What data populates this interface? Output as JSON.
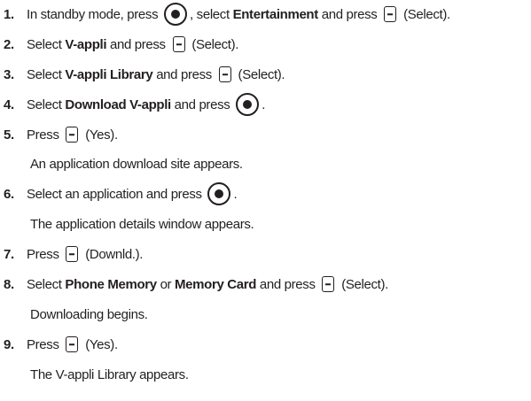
{
  "steps": [
    {
      "number": "1.",
      "parts": [
        {
          "text": "In standby mode, press "
        },
        {
          "icon": "center-key-icon"
        },
        {
          "text": ", select "
        },
        {
          "text": "Entertainment",
          "bold": true
        },
        {
          "text": " and press "
        },
        {
          "icon": "softkey-icon"
        },
        {
          "text": " (Select)."
        }
      ]
    },
    {
      "number": "2.",
      "parts": [
        {
          "text": "Select "
        },
        {
          "text": "V-appli",
          "bold": true
        },
        {
          "text": " and press "
        },
        {
          "icon": "softkey-icon"
        },
        {
          "text": " (Select)."
        }
      ]
    },
    {
      "number": "3.",
      "parts": [
        {
          "text": "Select "
        },
        {
          "text": "V-appli Library",
          "bold": true
        },
        {
          "text": " and press "
        },
        {
          "icon": "softkey-icon"
        },
        {
          "text": " (Select)."
        }
      ]
    },
    {
      "number": "4.",
      "parts": [
        {
          "text": "Select "
        },
        {
          "text": "Download V-appli",
          "bold": true
        },
        {
          "text": " and press "
        },
        {
          "icon": "center-key-icon"
        },
        {
          "text": "."
        }
      ]
    },
    {
      "number": "5.",
      "parts": [
        {
          "text": "Press "
        },
        {
          "icon": "softkey-icon"
        },
        {
          "text": " (Yes)."
        }
      ],
      "note": "An application download site appears."
    },
    {
      "number": "6.",
      "parts": [
        {
          "text": "Select an application and press "
        },
        {
          "icon": "center-key-icon"
        },
        {
          "text": "."
        }
      ],
      "note": "The application details window appears."
    },
    {
      "number": "7.",
      "parts": [
        {
          "text": "Press "
        },
        {
          "icon": "softkey-icon"
        },
        {
          "text": " (Downld.)."
        }
      ]
    },
    {
      "number": "8.",
      "parts": [
        {
          "text": "Select "
        },
        {
          "text": "Phone Memory",
          "bold": true
        },
        {
          "text": " or "
        },
        {
          "text": "Memory Card",
          "bold": true
        },
        {
          "text": " and press "
        },
        {
          "icon": "softkey-icon"
        },
        {
          "text": " (Select)."
        }
      ],
      "note": "Downloading begins."
    },
    {
      "number": "9.",
      "parts": [
        {
          "text": "Press "
        },
        {
          "icon": "softkey-icon"
        },
        {
          "text": " (Yes)."
        }
      ],
      "note": "The V-appli Library appears."
    }
  ]
}
